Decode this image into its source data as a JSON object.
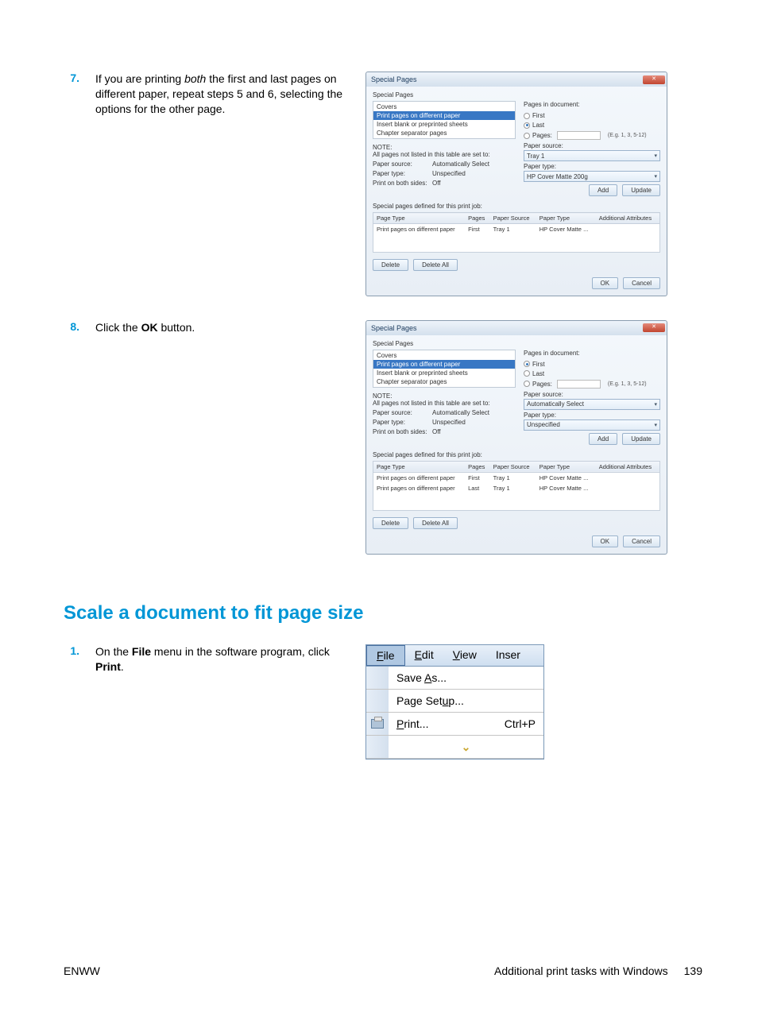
{
  "step7": {
    "num": "7.",
    "text_part1": "If you are printing ",
    "text_em": "both",
    "text_part2": " the first and last pages on different paper, repeat steps 5 and 6, selecting the options for the other page."
  },
  "step8": {
    "num": "8.",
    "text_part1": "Click the ",
    "text_bold": "OK",
    "text_part2": " button."
  },
  "dialog1": {
    "title": "Special Pages",
    "group": "Special Pages",
    "list": {
      "covers": "Covers",
      "print_pages": "Print pages on different paper",
      "insert_blank": "Insert blank or preprinted sheets",
      "chapter_sep": "Chapter separator pages"
    },
    "note_label": "NOTE:",
    "note_text": "All pages not listed in this table are set to:",
    "paper_source_label": "Paper source:",
    "paper_source_val": "Automatically Select",
    "paper_type_label": "Paper type:",
    "paper_type_val": "Unspecified",
    "print_both_label": "Print on both sides:",
    "print_both_val": "Off",
    "pages_in_doc": "Pages in document:",
    "radio_first": "First",
    "radio_last": "Last",
    "radio_pages": "Pages:",
    "eg": "(E.g. 1, 3, 5-12)",
    "ps_label": "Paper source:",
    "ps_val": "Tray 1",
    "pt_label": "Paper type:",
    "pt_val": "HP Cover Matte 200g",
    "add_btn": "Add",
    "update_btn": "Update",
    "defined": "Special pages defined for this print job:",
    "th_page_type": "Page Type",
    "th_pages": "Pages",
    "th_paper_source": "Paper Source",
    "th_paper_type": "Paper Type",
    "th_additional": "Additional Attributes",
    "row1_type": "Print pages on different paper",
    "row1_pages": "First",
    "row1_source": "Tray 1",
    "row1_ptype": "HP Cover Matte ...",
    "delete_btn": "Delete",
    "delete_all_btn": "Delete All",
    "ok_btn": "OK",
    "cancel_btn": "Cancel"
  },
  "dialog2": {
    "title": "Special Pages",
    "radio_first": "First",
    "radio_last": "Last",
    "radio_pages": "Pages:",
    "ps_val": "Automatically Select",
    "pt_val": "Unspecified",
    "row1_type": "Print pages on different paper",
    "row1_pages": "First",
    "row1_source": "Tray 1",
    "row1_ptype": "HP Cover Matte ...",
    "row2_type": "Print pages on different paper",
    "row2_pages": "Last",
    "row2_source": "Tray 1",
    "row2_ptype": "HP Cover Matte ..."
  },
  "heading": "Scale a document to fit page size",
  "step1": {
    "num": "1.",
    "text_part1": "On the ",
    "text_bold1": "File",
    "text_part2": " menu in the software program, click ",
    "text_bold2": "Print",
    "text_part3": "."
  },
  "menu": {
    "file": "File",
    "edit": "Edit",
    "view": "View",
    "inser": "Inser",
    "save_as_s": "Save ",
    "save_as_u": "A",
    "save_as_e": "s...",
    "page_setup_s": "Page Set",
    "page_setup_u": "u",
    "page_setup_e": "p...",
    "print_u": "P",
    "print_e": "rint...",
    "print_short": "Ctrl+P"
  },
  "footer": {
    "left": "ENWW",
    "center": "Additional print tasks with Windows",
    "pagenum": "139"
  }
}
